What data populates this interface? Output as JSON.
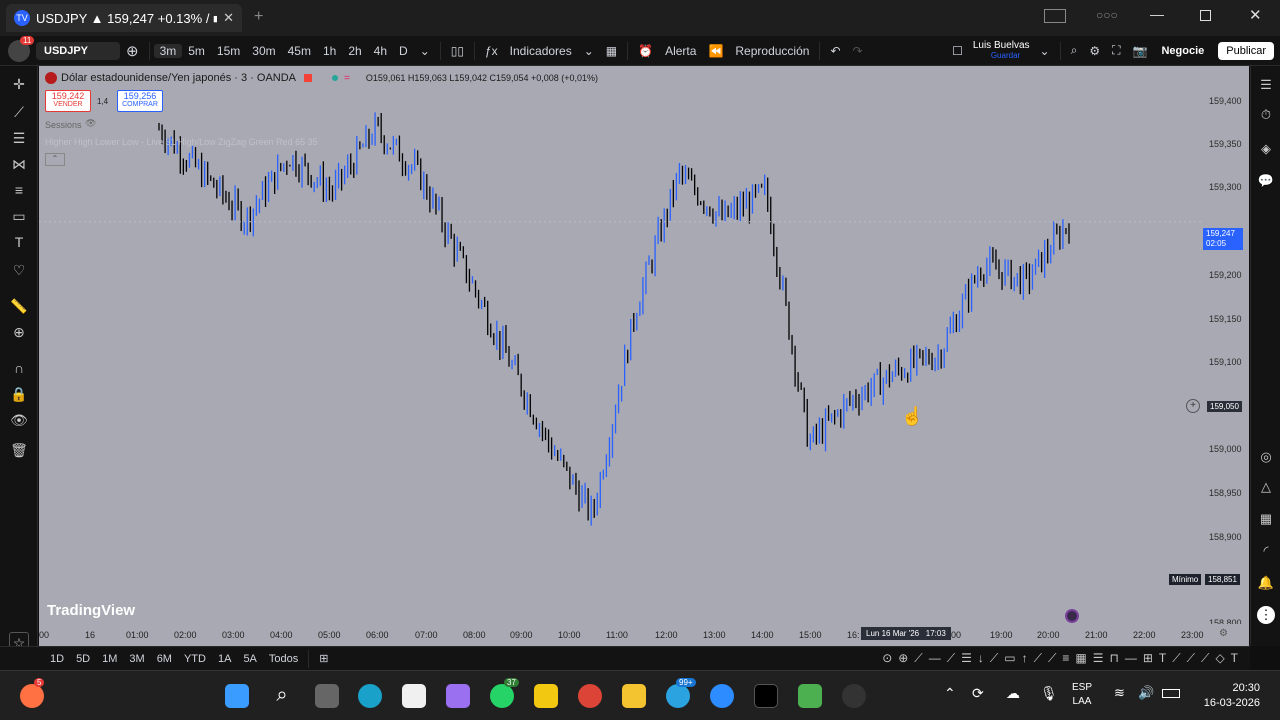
{
  "browser": {
    "tab_title": "USDJPY ▲ 159,247 +0.13% / ■"
  },
  "toolbar": {
    "avatar_badge": "11",
    "symbol": "USDJPY",
    "intervals": [
      "3m",
      "5m",
      "15m",
      "30m",
      "45m",
      "1h",
      "2h",
      "4h",
      "D"
    ],
    "indicators_label": "Indicadores",
    "alert_label": "Alerta",
    "replay_label": "Reproducción",
    "layout_name": "Luis Buelvas",
    "layout_sub": "Guardar",
    "trade_label": "Negocie",
    "publish_label": "Publicar"
  },
  "legend": {
    "title": "Dólar estadounidense/Yen japonés · 3 · OANDA",
    "ohlc": "O159,061 H159,063 L159,042 C159,054 +0,008 (+0,01%)",
    "sell_price": "159,242",
    "sell_label": "VENDER",
    "spread": "1,4",
    "buy_price": "159,256",
    "buy_label": "COMPRAR",
    "sessions": "Sessions",
    "indicator": "Higher High Lower Low - Live 31 High/Low ZigZag Green Red 65 35"
  },
  "watermark": "TradingView",
  "price_axis": {
    "ticks": [
      "159,400",
      "159,350",
      "159,300",
      "159,250",
      "159,200",
      "159,150",
      "159,100",
      "159,050",
      "159,000",
      "158,950",
      "158,900",
      "158,850",
      "158,800"
    ],
    "current_price": "159,247",
    "countdown": "02:05",
    "crosshair_price": "159,050",
    "min_label": "Mínimo",
    "min_price": "158,851",
    "accent_color": "#2962ff"
  },
  "time_axis": {
    "ticks": [
      "00",
      "16",
      "01:00",
      "02:00",
      "03:00",
      "04:00",
      "05:00",
      "06:00",
      "07:00",
      "08:00",
      "09:00",
      "10:00",
      "11:00",
      "12:00",
      "13:00",
      "14:00",
      "15:00",
      "16:",
      "00",
      "19:00",
      "20:00",
      "21:00",
      "22:00",
      "23:00"
    ],
    "crosshair_time": "Lun 16 Mar '26   17:03"
  },
  "chart_data": {
    "type": "bar",
    "title": "Dólar estadounidense/Yen japonés · 3 · OANDA",
    "ylim": [
      158.8,
      159.42
    ],
    "x": [
      "00:00",
      "01:00",
      "02:00",
      "03:00",
      "04:00",
      "05:00",
      "06:00",
      "07:00",
      "08:00",
      "09:00",
      "10:00",
      "11:00",
      "12:00",
      "13:00",
      "14:00",
      "15:00",
      "16:00",
      "17:00",
      "18:00",
      "19:00",
      "20:00",
      "20:30"
    ],
    "close": [
      159.35,
      159.3,
      159.25,
      159.32,
      159.28,
      159.35,
      159.3,
      159.2,
      159.1,
      159.0,
      158.92,
      159.15,
      159.3,
      159.25,
      159.28,
      159.0,
      159.05,
      159.08,
      159.1,
      159.2,
      159.18,
      159.247
    ],
    "up_color": "#2962ff",
    "down_color": "#000000"
  },
  "bottom_bar": {
    "ranges": [
      "1D",
      "5D",
      "1M",
      "3M",
      "6M",
      "YTD",
      "1A",
      "5A",
      "Todos"
    ]
  },
  "taskbar": {
    "lang": "ESP",
    "lang_sub": "LAA",
    "time": "20:30",
    "date": "16-03-2026",
    "whatsapp_badge": "37",
    "telegram_badge": "99+",
    "app_badge": "5"
  }
}
